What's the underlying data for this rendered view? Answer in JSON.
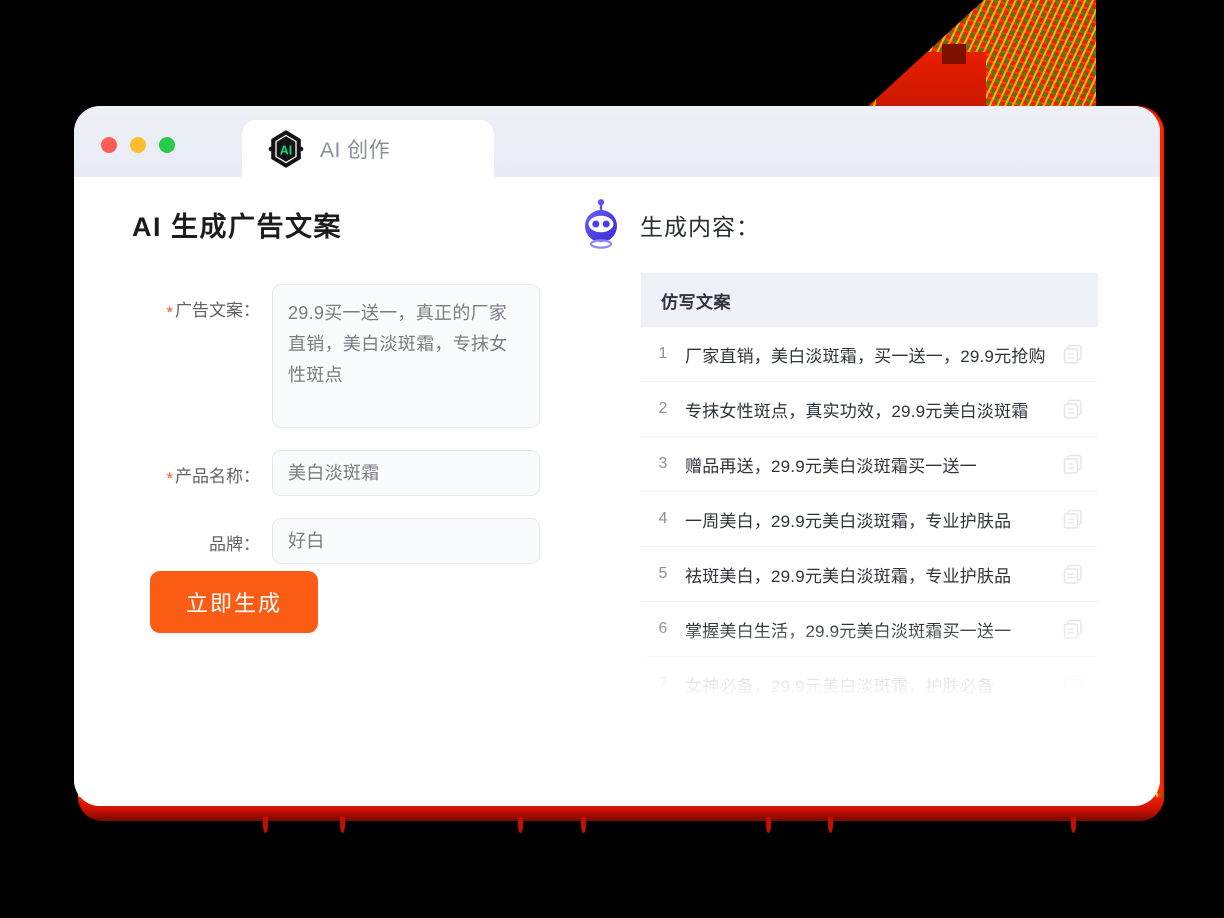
{
  "window": {
    "traffic_lights": [
      {
        "name": "close",
        "color": "#ff5e57"
      },
      {
        "name": "minimize",
        "color": "#fcbd2e"
      },
      {
        "name": "maximize",
        "color": "#2bc94b"
      }
    ],
    "tab": {
      "label": "AI 创作",
      "logo_text": "AI",
      "logo_color": "#13d67a",
      "icon": "ai-hexagon-logo"
    }
  },
  "left": {
    "title": "AI 生成广告文案",
    "fields": [
      {
        "label": "广告文案：",
        "required": true,
        "type": "textarea",
        "value": "29.9买一送一，真正的厂家直销，美白淡斑霜，专抹女性斑点"
      },
      {
        "label": "产品名称：",
        "required": true,
        "type": "input",
        "value": "美白淡斑霜"
      },
      {
        "label": "品牌：",
        "required": false,
        "type": "input",
        "value": "好白"
      }
    ],
    "submit_label": "立即生成",
    "submit_color": "#fb5c13"
  },
  "right": {
    "title": "生成内容：",
    "robot_icon": "robot-head-icon",
    "table": {
      "column_header": "仿写文案",
      "rows": [
        {
          "index": "1",
          "text": "厂家直销，美白淡斑霜，买一送一，29.9元抢购"
        },
        {
          "index": "2",
          "text": "专抹女性斑点，真实功效，29.9元美白淡斑霜"
        },
        {
          "index": "3",
          "text": "赠品再送，29.9元美白淡斑霜买一送一"
        },
        {
          "index": "4",
          "text": "一周美白，29.9元美白淡斑霜，专业护肤品"
        },
        {
          "index": "5",
          "text": "祛斑美白，29.9元美白淡斑霜，专业护肤品"
        },
        {
          "index": "6",
          "text": "掌握美白生活，29.9元美白淡斑霜买一送一"
        },
        {
          "index": "7",
          "text": "女神必备，29.9元美白淡斑霜，护肤必备"
        }
      ],
      "row_action_icon": "copy-icon"
    }
  }
}
